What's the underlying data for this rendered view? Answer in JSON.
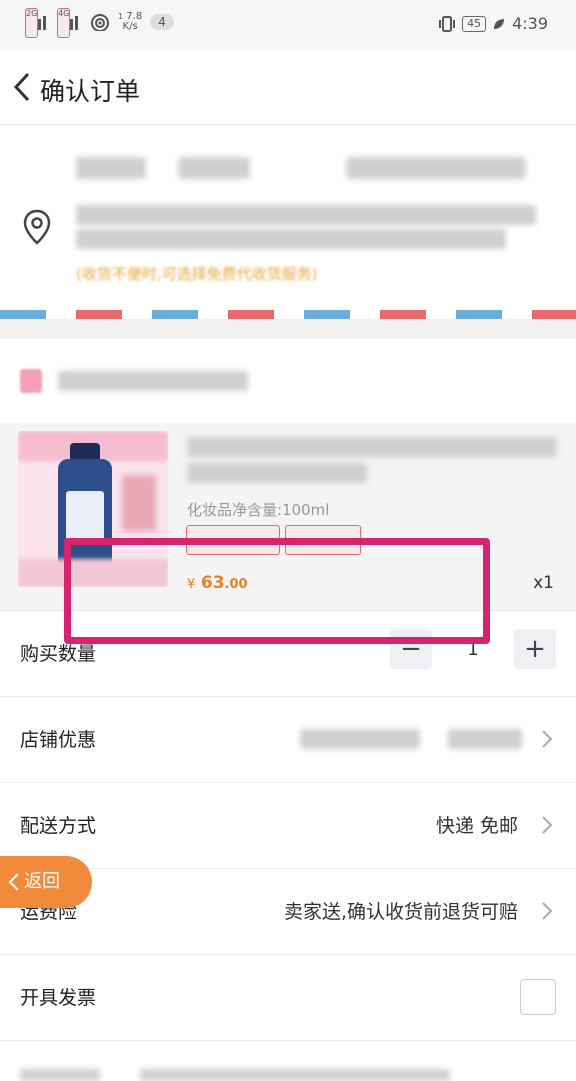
{
  "status_bar": {
    "signal1_type": "2G",
    "signal2_type": "4G",
    "net_speed_value": "7.8",
    "net_speed_unit": "K/s",
    "net_speed_prefix": "1",
    "notif_count": "4",
    "battery": "45",
    "time": "4:39"
  },
  "header": {
    "title": "确认订单"
  },
  "address": {
    "note": "(收货不便时,可选择免费代收货服务)"
  },
  "product": {
    "spec": "化妆品净含量:100ml",
    "price_currency": "¥",
    "price_int": "63",
    "price_dec": ".00",
    "quantity_label": "x1"
  },
  "rows": {
    "quantity": {
      "label": "购买数量",
      "minus": "−",
      "value": "1",
      "plus": "+"
    },
    "store_discount": {
      "label": "店铺优惠"
    },
    "delivery": {
      "label": "配送方式",
      "value": "快递 免邮"
    },
    "freight_insurance": {
      "label": "运费险",
      "value": "卖家送,确认收货前退货可赔"
    },
    "invoice": {
      "label": "开具发票"
    }
  },
  "float_back": {
    "label": "返回"
  },
  "colors": {
    "price": "#e8802d",
    "highlight": "#d6246e",
    "float_back": "#f28a3b",
    "note": "#e9a53c"
  }
}
